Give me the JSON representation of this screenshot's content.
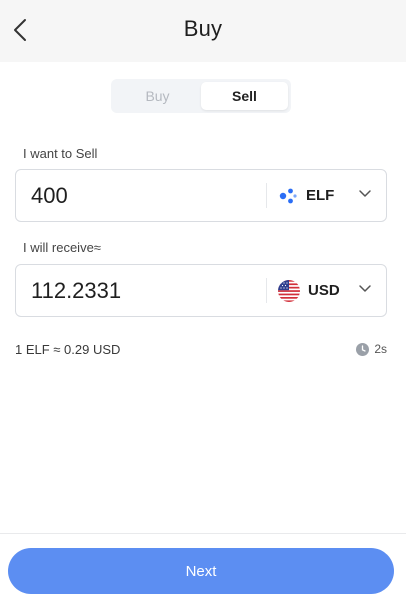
{
  "header": {
    "title": "Buy",
    "back_icon": "chevron-left-icon"
  },
  "tabs": [
    {
      "label": "Buy",
      "active": false
    },
    {
      "label": "Sell",
      "active": true
    }
  ],
  "sell_field": {
    "label": "I want to Sell",
    "value": "400",
    "currency": "ELF",
    "currency_icon": "elf-token-icon"
  },
  "receive_field": {
    "label": "I will receive≈",
    "value": "112.2331",
    "currency": "USD",
    "currency_icon": "us-flag-icon"
  },
  "rate": {
    "text": "1 ELF ≈ 0.29 USD",
    "timer": "2s",
    "timer_icon": "clock-icon"
  },
  "footer": {
    "next_label": "Next"
  },
  "colors": {
    "primary": "#5c8ef2",
    "header_bg": "#f6f6f6",
    "elf_blue": "#2b6ef5"
  }
}
